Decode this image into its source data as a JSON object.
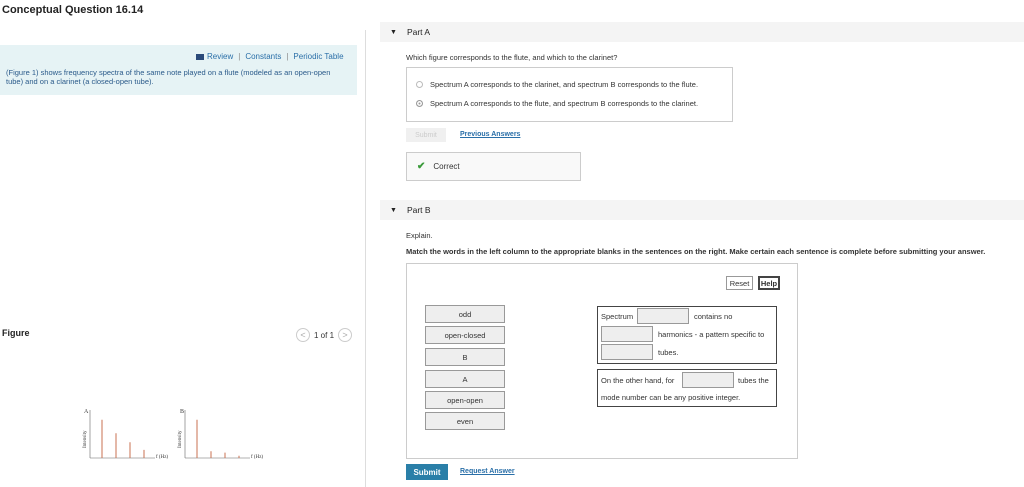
{
  "page_title": "Conceptual Question 16.14",
  "left": {
    "links": [
      "Review",
      "Constants",
      "Periodic Table"
    ],
    "figure_description": "(Figure 1) shows frequency spectra of the same note played on a flute (modeled as an open-open tube) and on a clarinet (a closed-open tube).",
    "figure_label": "Figure",
    "pager": "1 of 1",
    "spectrum_a_label": "A",
    "spectrum_b_label": "B",
    "y_axis_label": "Intensity",
    "x_axis_label": "f (Hz)",
    "spectrum_a_values": [
      0.85,
      0.55,
      0.35,
      0.18
    ],
    "spectrum_b_values": [
      0.85,
      0.15,
      0.12,
      0.05
    ]
  },
  "part_a": {
    "header": "Part A",
    "question": "Which figure corresponds to the flute, and which to the clarinet?",
    "choices": [
      "Spectrum A corresponds to the clarinet, and spectrum B corresponds to the flute.",
      "Spectrum A corresponds to the flute, and spectrum B corresponds to the clarinet."
    ],
    "selected_index": 1,
    "submit_label": "Submit",
    "previous_answers_label": "Previous Answers",
    "feedback": "Correct"
  },
  "part_b": {
    "header": "Part B",
    "explain": "Explain.",
    "instructions": "Match the words in the left column to the appropriate blanks in the sentences on the right. Make certain each sentence is complete before submitting your answer.",
    "reset_label": "Reset",
    "help_label": "Help",
    "words": [
      "odd",
      "open-closed",
      "B",
      "A",
      "open-open",
      "even"
    ],
    "sentence1": {
      "part1": "Spectrum",
      "part2": "contains no",
      "part3": "harmonics - a pattern specific to",
      "part4": "tubes."
    },
    "sentence2": {
      "part1": "On the other hand, for",
      "part2": "tubes the",
      "part3": "mode number can be any positive integer."
    },
    "submit_label": "Submit",
    "request_answer_label": "Request Answer"
  }
}
